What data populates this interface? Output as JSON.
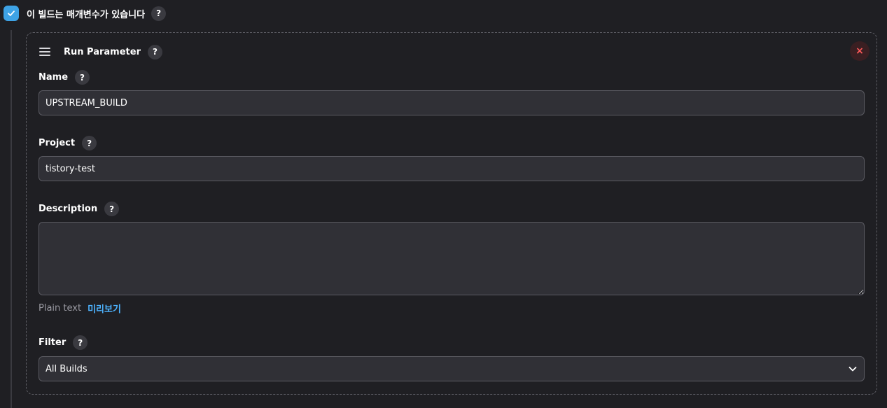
{
  "params_toggle": {
    "label": "이 빌드는 매개변수가 있습니다",
    "checked": true,
    "help": "?"
  },
  "parameter": {
    "title": "Run Parameter",
    "help": "?",
    "close": "×",
    "name": {
      "label": "Name",
      "help": "?",
      "value": "UPSTREAM_BUILD"
    },
    "project": {
      "label": "Project",
      "help": "?",
      "value": "tistory-test"
    },
    "description": {
      "label": "Description",
      "help": "?",
      "value": "",
      "format_text": "Plain text",
      "preview_link": "미리보기"
    },
    "filter": {
      "label": "Filter",
      "help": "?",
      "selected": "All Builds"
    }
  },
  "colors": {
    "background": "#1f1f23",
    "accent": "#3ea3e6",
    "link": "#4db3ff",
    "danger": "#ff5a5a"
  }
}
